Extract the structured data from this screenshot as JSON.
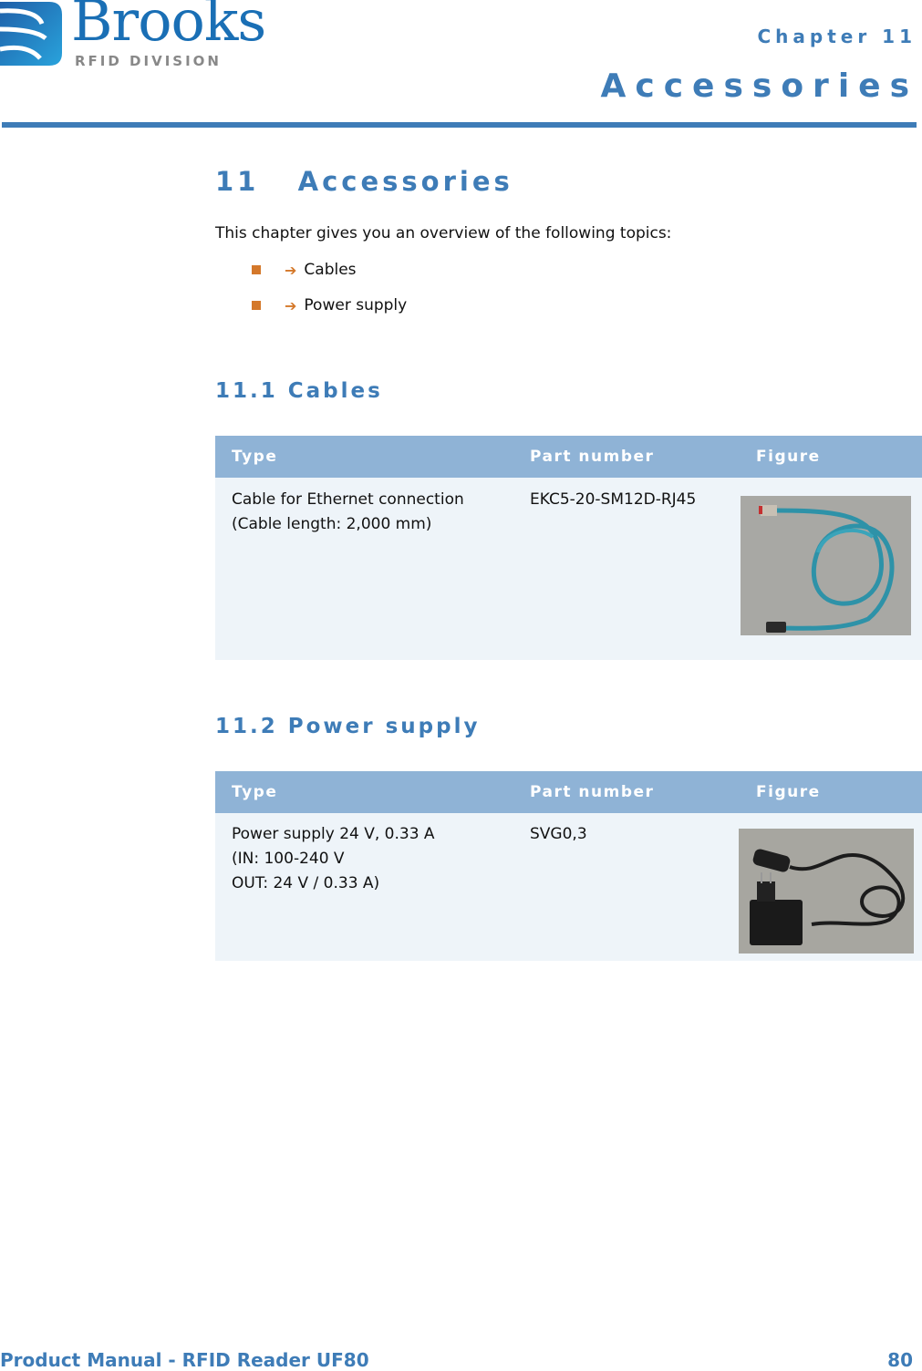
{
  "header": {
    "logo_word": "Brooks",
    "logo_sub": "RFID DIVISION",
    "chapter_label": "Chapter 11",
    "chapter_title": "Accessories"
  },
  "section": {
    "number": "11",
    "title": "Accessories",
    "heading": "11   Accessories",
    "intro": "This chapter gives you an overview of the following topics:",
    "topics": [
      {
        "label": "Cables"
      },
      {
        "label": "Power supply"
      }
    ]
  },
  "cables": {
    "heading": "11.1 Cables",
    "columns": [
      "Type",
      "Part number",
      "Figure"
    ],
    "rows": [
      {
        "type": "Cable for Ethernet connection\n(Cable length: 2,000 mm)",
        "part_number": "EKC5-20-SM12D-RJ45",
        "figure": "ethernet-cable-photo"
      }
    ]
  },
  "power_supply": {
    "heading": "11.2 Power supply",
    "columns": [
      "Type",
      "Part number",
      "Figure"
    ],
    "rows": [
      {
        "type": "Power supply 24 V, 0.33 A\n(IN: 100-240 V\nOUT: 24 V / 0.33 A)",
        "part_number": "SVG0,3",
        "figure": "power-supply-photo"
      }
    ]
  },
  "footer": {
    "title": "Product Manual - RFID Reader UF80",
    "page_number": "80"
  },
  "colors": {
    "brand_blue": "#3e7cb7",
    "table_header": "#8fb3d6",
    "table_body": "#eef4f9",
    "bullet_orange": "#d4782a"
  }
}
